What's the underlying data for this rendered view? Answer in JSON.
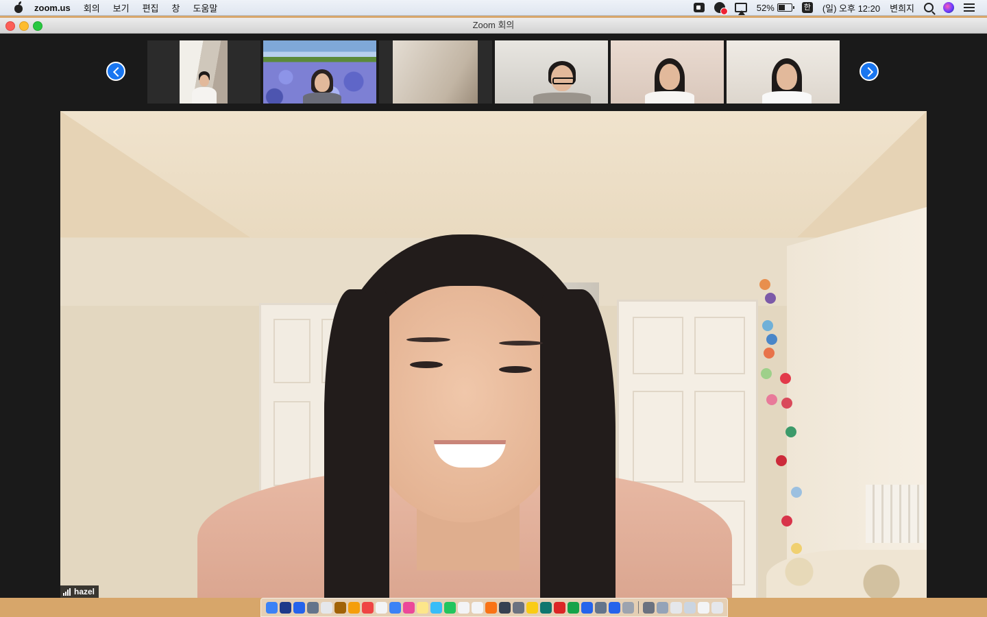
{
  "menubar": {
    "app_name": "zoom.us",
    "menus": [
      "회의",
      "보기",
      "편집",
      "창",
      "도움말"
    ],
    "battery": "52%",
    "input_source": "한",
    "datetime": "(일) 오후 12:20",
    "user": "변희지"
  },
  "window": {
    "title": "Zoom 회의"
  },
  "participants_strip": {
    "thumbnail_count": 6
  },
  "active_speaker": {
    "name": "hazel"
  },
  "dock": {
    "colors": [
      "#3b82f6",
      "#1e3a8a",
      "#2563eb",
      "#64748b",
      "#e5e7eb",
      "#a16207",
      "#f59e0b",
      "#ef4444",
      "#f3f4f6",
      "#3b82f6",
      "#ec4899",
      "#fde68a",
      "#38bdf8",
      "#22c55e",
      "#f3f4f6",
      "#f3f4f6",
      "#f97316",
      "#374151",
      "#6b7280",
      "#facc15",
      "#0f766e",
      "#dc2626",
      "#16a34a",
      "#2563eb",
      "#64748b",
      "#2563eb",
      "#9ca3af",
      "#6b7280",
      "#94a3b8",
      "#e5e7eb",
      "#cbd5e1",
      "#f3f4f6",
      "#e5e7eb"
    ]
  }
}
